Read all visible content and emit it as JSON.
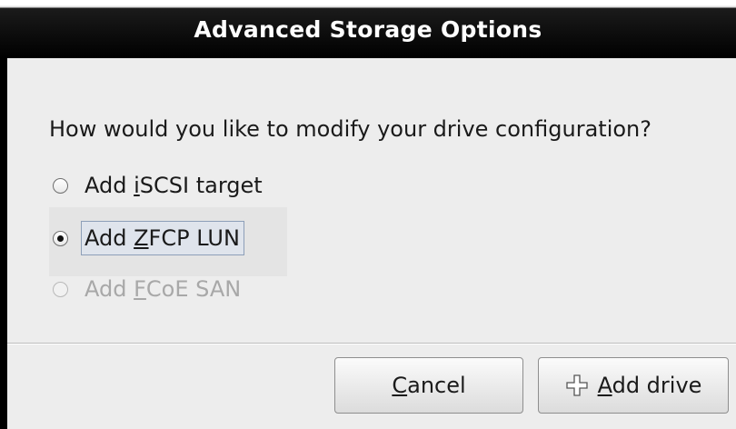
{
  "window": {
    "title": "Advanced Storage Options"
  },
  "dialog": {
    "question": "How would you like to modify your drive configuration?",
    "options": [
      {
        "pre": "Add ",
        "mnemonic": "i",
        "post": "SCSI target",
        "selected": false,
        "enabled": true
      },
      {
        "pre": "Add ",
        "mnemonic": "Z",
        "post": "FCP LUN",
        "selected": true,
        "enabled": true
      },
      {
        "pre": "Add ",
        "mnemonic": "F",
        "post": "CoE SAN",
        "selected": false,
        "enabled": false
      }
    ]
  },
  "buttons": {
    "cancel": {
      "mnemonic": "C",
      "post": "ancel"
    },
    "add_drive": {
      "pre": "",
      "mnemonic": "A",
      "post": "dd drive",
      "icon": "plus-icon"
    }
  }
}
